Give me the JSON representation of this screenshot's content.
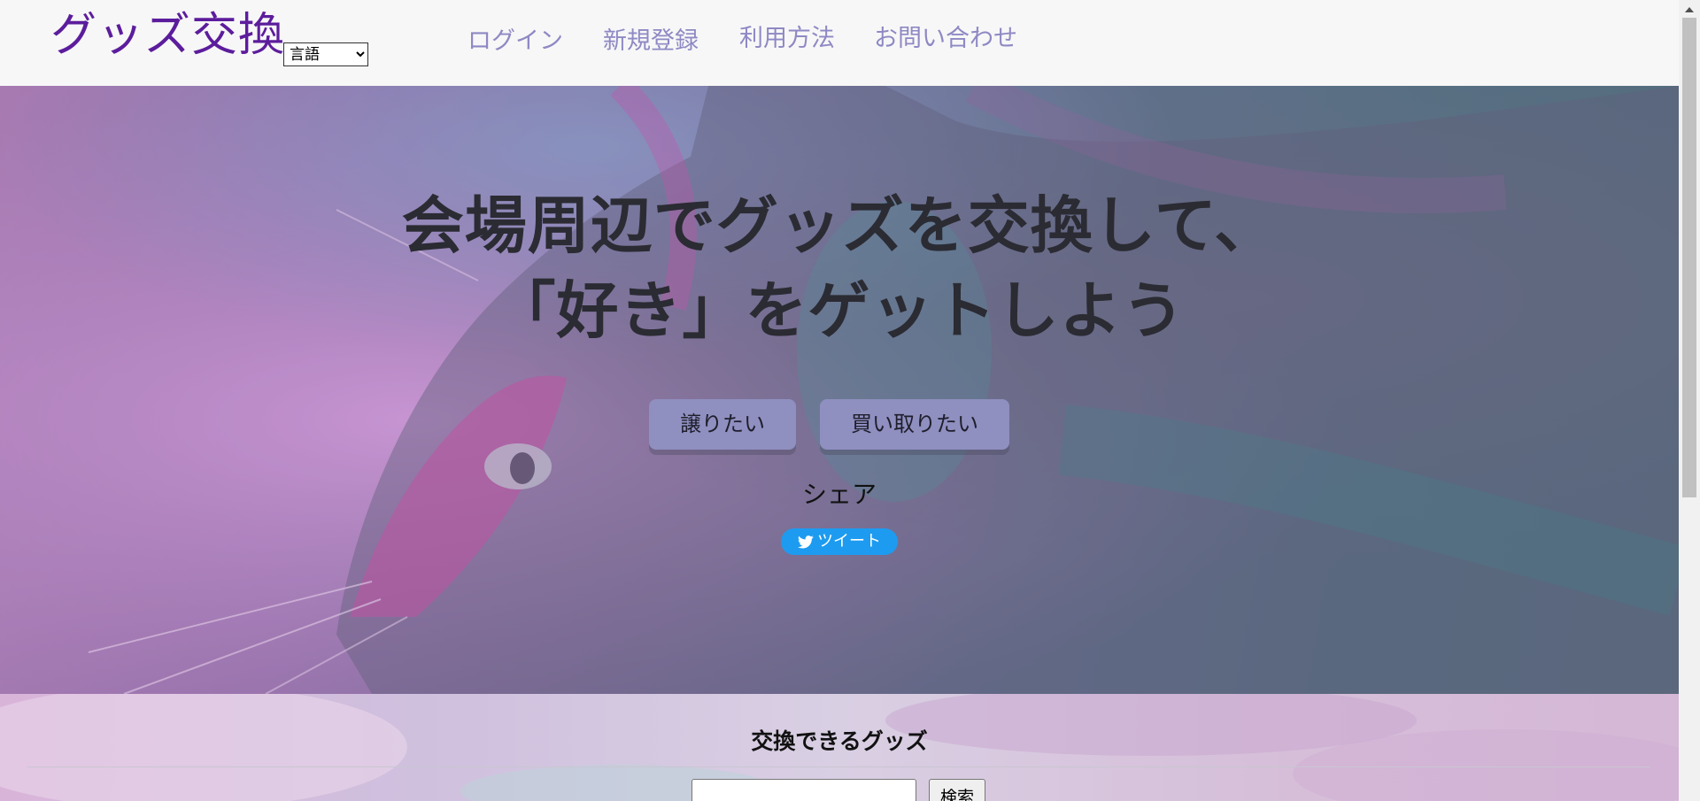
{
  "header": {
    "logo": "グッズ交換",
    "language_select": {
      "selected": "言語",
      "options": [
        "言語"
      ]
    },
    "nav": [
      {
        "label": "ログイン"
      },
      {
        "label": "新規登録"
      },
      {
        "label": "利用方法"
      },
      {
        "label": "お問い合わせ"
      }
    ]
  },
  "hero": {
    "title_line1": "会場周辺でグッズを交換して、",
    "title_line2": "「好き」をゲットしよう",
    "buttons": {
      "sell": "譲りたい",
      "buy": "買い取りたい"
    },
    "share_label": "シェア",
    "tweet_label": "ツイート"
  },
  "goods": {
    "title": "交換できるグッズ",
    "search_button": "検索",
    "search_value": ""
  },
  "colors": {
    "logo": "#5c1d9c",
    "nav_link": "#8e89c4",
    "button_bg": "#8f8fc0",
    "tweet_bg": "#1d9bf0"
  }
}
